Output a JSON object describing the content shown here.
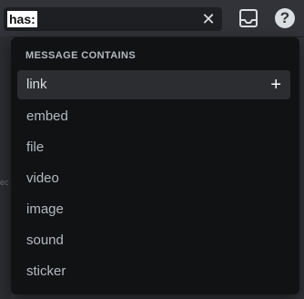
{
  "search": {
    "value": "has:"
  },
  "icons": {
    "clear": "close-icon",
    "inbox": "inbox-icon",
    "help": "help-icon",
    "add": "plus-icon"
  },
  "topbar": {
    "help_glyph": "?"
  },
  "background_text": "ec",
  "dropdown": {
    "header": "MESSAGE CONTAINS",
    "items": [
      {
        "label": "link",
        "active": true
      },
      {
        "label": "embed",
        "active": false
      },
      {
        "label": "file",
        "active": false
      },
      {
        "label": "video",
        "active": false
      },
      {
        "label": "image",
        "active": false
      },
      {
        "label": "sound",
        "active": false
      },
      {
        "label": "sticker",
        "active": false
      }
    ]
  },
  "colors": {
    "background": "#313338",
    "dropdown": "#111214",
    "active_item": "#2b2d31",
    "text": "#b5bac1"
  }
}
